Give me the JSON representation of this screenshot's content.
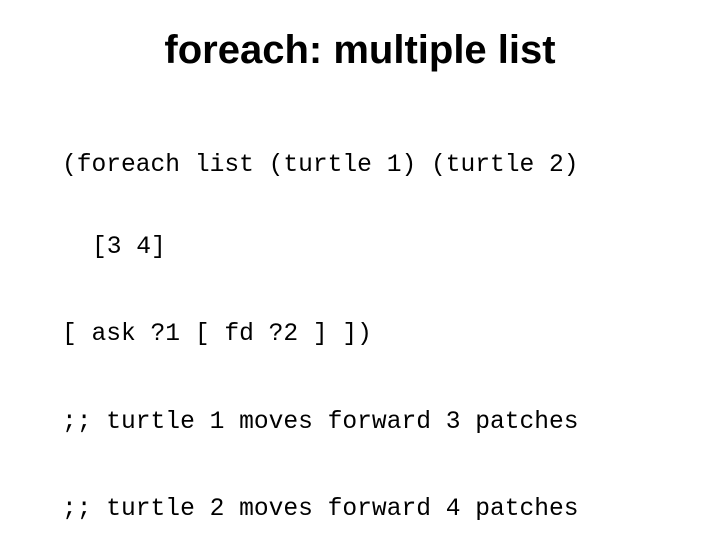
{
  "slide": {
    "title": "foreach: multiple list",
    "code_lines": [
      "(foreach list (turtle 1) (turtle 2)",
      "[3 4]",
      "[ ask ?1 [ fd ?2 ] ])",
      ";; turtle 1 moves forward 3 patches",
      ";; turtle 2 moves forward 4 patches"
    ]
  }
}
